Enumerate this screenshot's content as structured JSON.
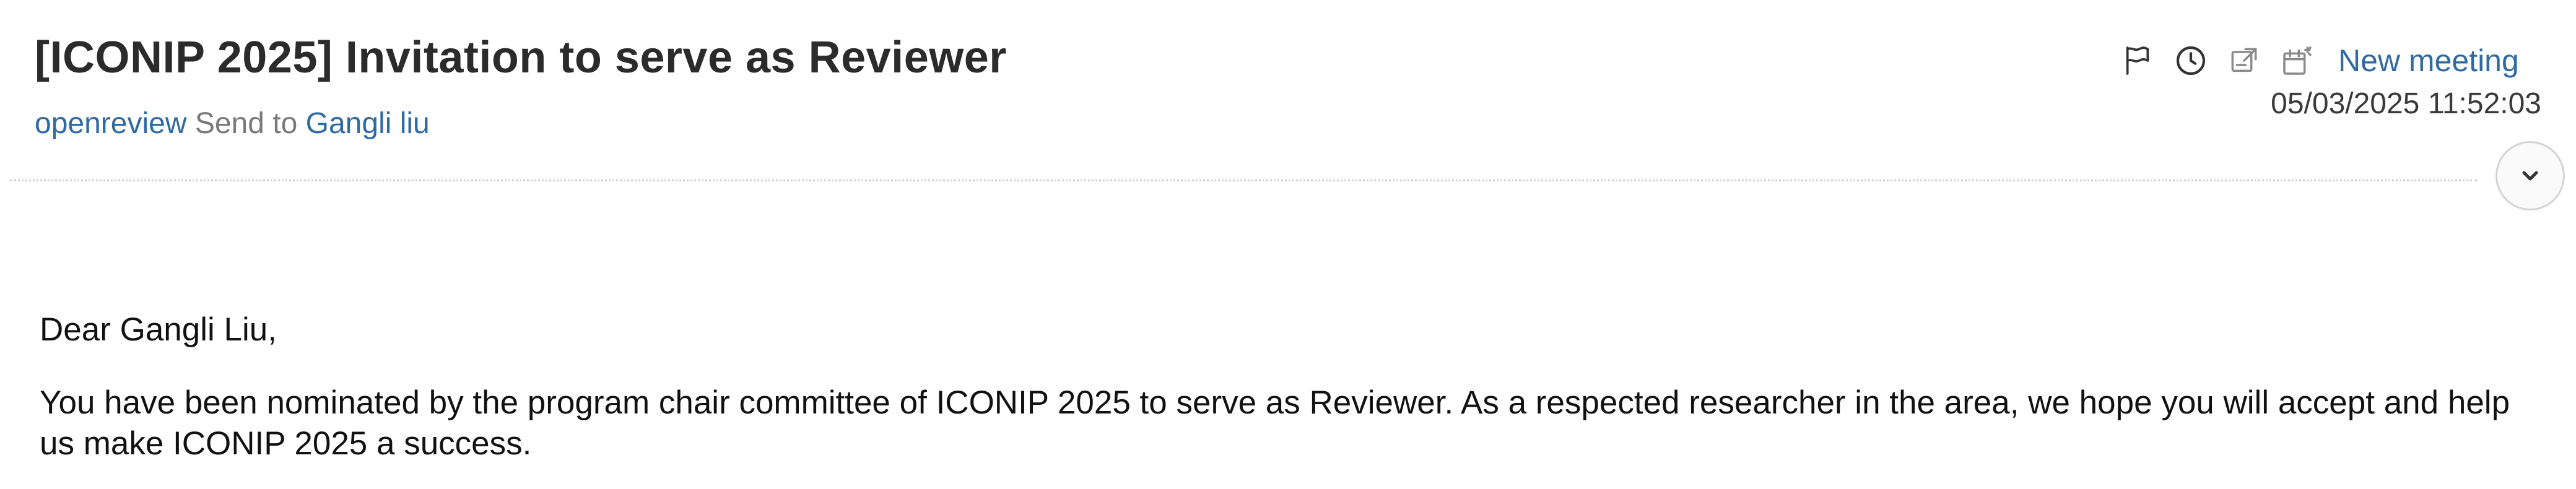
{
  "email": {
    "subject": "[ICONIP 2025] Invitation to serve as Reviewer",
    "sender": "openreview",
    "send_to_label": "Send to",
    "recipient": "Gangli liu",
    "timestamp": "05/03/2025 11:52:03"
  },
  "toolbar": {
    "icons": [
      "flag-icon",
      "clock-icon",
      "forward-icon",
      "schedule-icon"
    ],
    "new_meeting_label": "New meeting"
  },
  "body": {
    "greeting": "Dear Gangli Liu,",
    "paragraph1": "You have been nominated by the program chair committee of ICONIP 2025 to serve as Reviewer. As a respected researcher in the area, we hope you will accept and help us make ICONIP 2025 a success."
  },
  "colors": {
    "link": "#2f6aa3",
    "muted": "#7a7a7a",
    "subject": "#2b2b2b"
  }
}
